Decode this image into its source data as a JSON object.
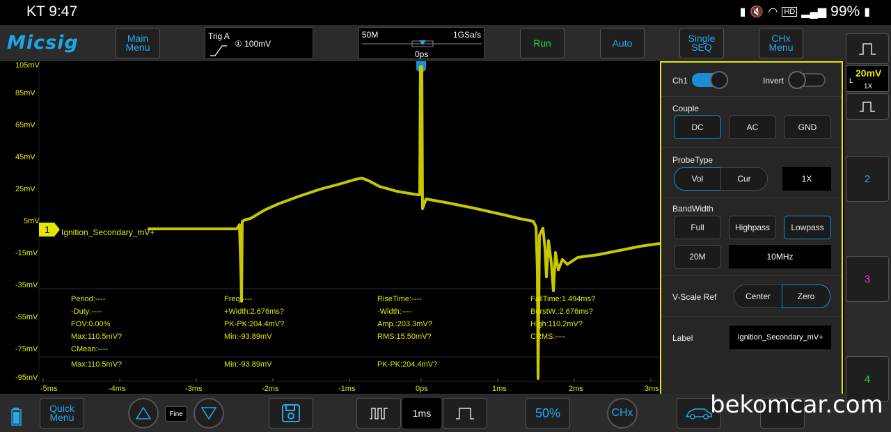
{
  "status_bar": {
    "carrier_time": "KT 9:47",
    "battery": "99%",
    "hd": "HD"
  },
  "toolbar": {
    "logo": "Micsig",
    "main_menu": "Main Menu",
    "trigger_label": "Trig A",
    "trigger_level": "① 100mV",
    "memory_depth": "50M",
    "sample_rate": "1GSa/s",
    "time_position": "0ps",
    "run": "Run",
    "auto": "Auto",
    "single_seq": "Single SEQ",
    "chx_menu": "CHx Menu"
  },
  "scope": {
    "y_labels": [
      "105mV",
      "85mV",
      "65mV",
      "45mV",
      "25mV",
      "5mV",
      "-15mV",
      "-35mV",
      "-55mV",
      "-75mV",
      "-95mV"
    ],
    "x_labels": [
      "-5ms",
      "-4ms",
      "-3ms",
      "-2ms",
      "-1ms",
      "0ps",
      "1ms",
      "2ms",
      "3ms"
    ],
    "channel_marker": "1",
    "channel_label": "Ignition_Secondary_mV+",
    "trace_color": "#c8c800"
  },
  "measurements": {
    "col1": [
      "Period:----",
      "-Duty:----",
      "FOV:0.00%",
      "Max:110.5mV?",
      "CMean:----",
      "Max:110.5mV?"
    ],
    "col2": [
      "Freq:----",
      "+Width:2.676ms?",
      "PK-PK:204.4mV?",
      "Min:-93.89mV",
      "",
      "Min:-93.89mV"
    ],
    "col3": [
      "RiseTime:----",
      "-Width:----",
      "Amp.:203.3mV?",
      "RMS:15.50mV?",
      "",
      "PK-PK:204.4mV?"
    ],
    "col4": [
      "FallTime:1.494ms?",
      "BurstW.:2.676ms?",
      "High:110.2mV?",
      "CRMS:----",
      "",
      ""
    ]
  },
  "panel": {
    "ch1_label": "Ch1",
    "invert_label": "Invert",
    "couple_title": "Couple",
    "couple_options": [
      "DC",
      "AC",
      "GND"
    ],
    "probe_title": "ProbeType",
    "probe_options": [
      "Vol",
      "Cur"
    ],
    "probe_ratio": "1X",
    "bandwidth_title": "BandWidth",
    "bandwidth_options": [
      "Full",
      "Highpass",
      "Lowpass"
    ],
    "bw_limit": "20M",
    "bw_value": "10MHz",
    "vscale_title": "V-Scale Ref",
    "vscale_options": [
      "Center",
      "Zero"
    ],
    "label_title": "Label",
    "label_value": "Ignition_Secondary_mV+"
  },
  "right_strip": {
    "ch1_scale": "20mV",
    "ch1_coupling_mark": "L",
    "ch1_probe": "1X",
    "ch2": "2",
    "ch3": "3",
    "ch4": "4"
  },
  "bottom_bar": {
    "quick_menu": "Quick Menu",
    "fine": "Fine",
    "timebase": "1ms",
    "fifty": "50%",
    "chx": "CHx"
  },
  "watermark": "bekomcar.com",
  "colors": {
    "accent": "#29a8ee",
    "trace": "#e6e600",
    "run": "#2bd63a",
    "panel_border": "#e6e600"
  }
}
